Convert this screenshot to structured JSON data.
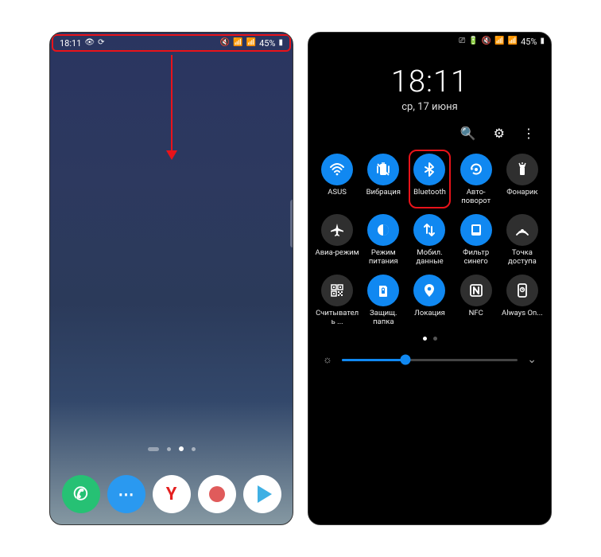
{
  "left": {
    "status": {
      "time": "18:11",
      "leftIcons": [
        "👁",
        "⟳"
      ],
      "rightIcons": [
        "🔇",
        "📶",
        "📶"
      ],
      "battery": "45%",
      "batteryIcon": "▮"
    },
    "dock": [
      {
        "name": "phone",
        "glyph": "✆"
      },
      {
        "name": "messages",
        "glyph": "⋯"
      },
      {
        "name": "yandex",
        "glyph": "Y"
      },
      {
        "name": "camera",
        "glyph": ""
      },
      {
        "name": "play",
        "glyph": ""
      }
    ]
  },
  "right": {
    "status": {
      "rightIcons": [
        "⎚",
        "🔋",
        "🔇",
        "📶",
        "📶"
      ],
      "battery": "45%",
      "batteryIcon": "▮"
    },
    "time": "18:11",
    "date": "ср, 17 июня",
    "actions": {
      "search": "🔍",
      "settings": "⚙",
      "more": "⋮"
    },
    "tiles": [
      {
        "label": "ASUS",
        "state": "on",
        "icon": "wifi",
        "hl": false
      },
      {
        "label": "Вибрация",
        "state": "on",
        "icon": "vibrate",
        "hl": false
      },
      {
        "label": "Bluetooth",
        "state": "on",
        "icon": "bluetooth",
        "hl": true
      },
      {
        "label": "Авто-поворот",
        "state": "on",
        "icon": "rotate",
        "hl": false
      },
      {
        "label": "Фонарик",
        "state": "off",
        "icon": "flashlight",
        "hl": false
      },
      {
        "label": "Авиа-режим",
        "state": "off",
        "icon": "airplane",
        "hl": false
      },
      {
        "label": "Режим питания",
        "state": "on",
        "icon": "power",
        "hl": false
      },
      {
        "label": "Мобил. данные",
        "state": "on",
        "icon": "data",
        "hl": false
      },
      {
        "label": "Фильтр синего",
        "state": "on",
        "icon": "bluefilter",
        "hl": false
      },
      {
        "label": "Точка доступа",
        "state": "off",
        "icon": "hotspot",
        "hl": false
      },
      {
        "label": "Считыватель ...",
        "state": "off",
        "icon": "qr",
        "hl": false
      },
      {
        "label": "Защищ. папка",
        "state": "on",
        "icon": "secure",
        "hl": false
      },
      {
        "label": "Локация",
        "state": "on",
        "icon": "location",
        "hl": false
      },
      {
        "label": "NFC",
        "state": "off",
        "icon": "nfc",
        "hl": false
      },
      {
        "label": "Always On...",
        "state": "off",
        "icon": "aod",
        "hl": false
      }
    ],
    "brightness": {
      "percent": 36
    },
    "iconGlyphs": {
      "wifi": "≋",
      "vibrate": "📳",
      "bluetooth": "✱",
      "rotate": "⟲",
      "flashlight": "▦",
      "airplane": "✈",
      "power": "◐",
      "data": "↕",
      "bluefilter": "◧",
      "hotspot": "◎",
      "qr": "▩",
      "secure": "🔒",
      "location": "📍",
      "nfc": "N",
      "aod": "▭"
    },
    "svgIcons": {
      "wifi": "<path d='M2 7 Q10 -1 18 7 M4.5 10 Q10 4 15.5 10 M7 13 Q10 10 13 13' stroke='white' stroke-width='2' fill='none' stroke-linecap='round'/><circle cx='10' cy='16' r='1.4' fill='white'/>",
      "vibrate": "<rect x='6' y='3' width='8' height='14' rx='1.5' fill='white'/><path d='M3 6 L3 14 M17 6 L17 14' stroke='white' stroke-width='1.8' stroke-linecap='round'/><path d='M8 2 L12 2' stroke='white' stroke-width='1.5'/><line x1='3' y1='3' x2='17' y2='17' stroke='white' stroke-width='1.8'/>",
      "bluetooth": "<path d='M10 2 L10 18 L15 13 L5 7 M10 2 L15 7 L5 13' stroke='white' stroke-width='2' fill='none' stroke-linejoin='round' stroke-linecap='round'/>",
      "rotate": "<path d='M4 10 A6 6 0 1 1 6 14' stroke='white' stroke-width='2' fill='none'/><path d='M3 8 L4 11 L7 9' fill='white'/><circle cx='10' cy='10' r='2' fill='white'/>",
      "flashlight": "<rect x='7' y='7' width='6' height='10' rx='1' fill='white'/><path d='M6 4 L14 4 L13 7 L7 7 Z' fill='white'/><line x1='10' y1='1' x2='10' y2='3' stroke='white' stroke-width='1.5'/><line x1='6' y1='2' x2='7' y2='4' stroke='white' stroke-width='1.5'/><line x1='14' y1='2' x2='13' y2='4' stroke='white' stroke-width='1.5'/>",
      "airplane": "<path d='M10 2 L11.5 8 L18 11 L18 12.5 L11.5 11 L11 15 L13 17 L13 18 L10 17 L7 18 L7 17 L9 15 L8.5 11 L2 12.5 L2 11 L8.5 8 Z' fill='white'/>",
      "power": "<circle cx='10' cy='10' r='7' fill='white'/><path d='M10 3 A7 7 0 0 1 10 17 Z' fill='#1088f1'/>",
      "data": "<path d='M7 3 L7 14 M4 6 L7 3 L10 6' stroke='white' stroke-width='2' fill='none' stroke-linecap='round' stroke-linejoin='round'/><path d='M13 6 L13 17 M10 14 L13 17 L16 14' stroke='white' stroke-width='2' fill='none' stroke-linecap='round' stroke-linejoin='round'/>",
      "bluefilter": "<rect x='4' y='3' width='12' height='14' rx='2' fill='white'/><rect x='6' y='5' width='8' height='8' fill='#1088f1'/>",
      "hotspot": "<circle cx='10' cy='11' r='2' fill='white'/><path d='M5 14 A6 6 0 0 1 15 14 M3 16 A9 9 0 0 1 17 16' stroke='white' stroke-width='1.8' fill='none' stroke-linecap='round'/>",
      "qr": "<rect x='3' y='3' width='6' height='6' stroke='white' stroke-width='1.5' fill='none'/><rect x='11' y='3' width='6' height='6' stroke='white' stroke-width='1.5' fill='none'/><rect x='3' y='11' width='6' height='6' stroke='white' stroke-width='1.5' fill='none'/><rect x='5' y='5' width='2' height='2' fill='white'/><rect x='13' y='5' width='2' height='2' fill='white'/><rect x='5' y='13' width='2' height='2' fill='white'/><rect x='11' y='11' width='2' height='2' fill='white'/><rect x='15' y='11' width='2' height='2' fill='white'/><rect x='11' y='15' width='2' height='2' fill='white'/><rect x='15' y='15' width='2' height='2' fill='white'/><rect x='13' y='13' width='2' height='2' fill='white'/>",
      "secure": "<path d='M5 4 L5 17 Q5 18 6 18 L14 18 Q15 18 15 17 L15 6 L13 4 Z' fill='white'/><rect x='8' y='10' width='4' height='4' rx='0.5' fill='#1088f1'/><path d='M8.5 10 L8.5 8.5 A1.5 1.5 0 0 1 11.5 8.5 L11.5 10' stroke='#1088f1' stroke-width='1.2' fill='none'/>",
      "location": "<path d='M10 2 A6 6 0 0 1 16 8 Q16 12 10 18 Q4 12 4 8 A6 6 0 0 1 10 2 Z' fill='white'/><circle cx='10' cy='8' r='2.3' fill='#1088f1'/>",
      "nfc": "<rect x='3' y='3' width='14' height='14' rx='2' stroke='white' stroke-width='1.8' fill='none'/><path d='M7 14 L7 6 L13 14 L13 6' stroke='white' stroke-width='2' fill='none' stroke-linejoin='round' stroke-linecap='round'/>",
      "aod": "<rect x='5' y='2' width='10' height='16' rx='2' stroke='white' stroke-width='1.8' fill='none'/><circle cx='10' cy='9' r='2.5' stroke='white' stroke-width='1.5' fill='none'/><line x1='10' y1='9' x2='10' y2='7.5' stroke='white' stroke-width='1.2'/><line x1='10' y1='9' x2='11.3' y2='9' stroke='white' stroke-width='1.2'/>"
    }
  }
}
